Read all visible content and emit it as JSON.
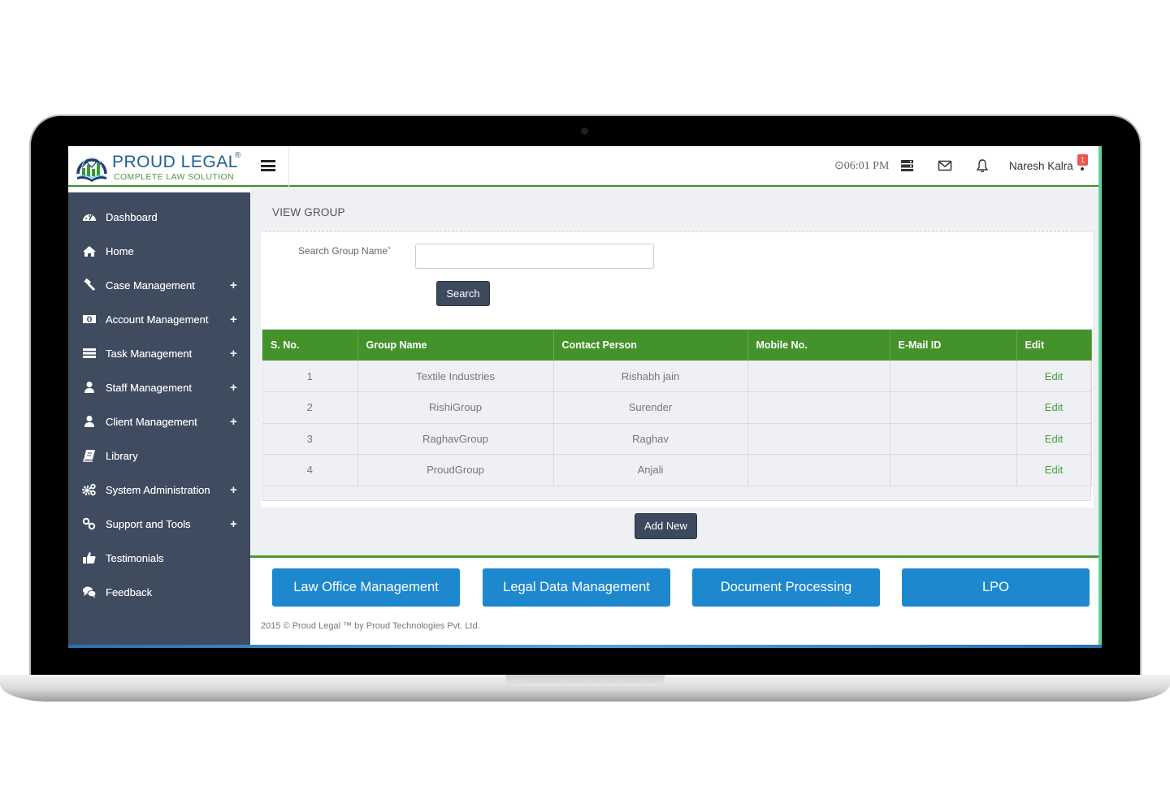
{
  "brand": {
    "title": "PROUD LEGAL",
    "registered": "®",
    "subtitle": "COMPLETE LAW SOLUTION"
  },
  "header": {
    "time": "06:01 PM",
    "user_name": "Naresh Kalra",
    "notification_count": "1",
    "icons": [
      "clock-icon",
      "server-icon",
      "envelope-icon",
      "bell-icon"
    ]
  },
  "sidebar": {
    "items": [
      {
        "label": "Dashboard",
        "icon": "dashboard-icon",
        "expandable": false
      },
      {
        "label": "Home",
        "icon": "home-icon",
        "expandable": false
      },
      {
        "label": "Case Management",
        "icon": "gavel-icon",
        "expandable": true
      },
      {
        "label": "Account Management",
        "icon": "money-icon",
        "expandable": true
      },
      {
        "label": "Task Management",
        "icon": "tasks-icon",
        "expandable": true
      },
      {
        "label": "Staff Management",
        "icon": "user-icon",
        "expandable": true
      },
      {
        "label": "Client Management",
        "icon": "user-icon",
        "expandable": true
      },
      {
        "label": "Library",
        "icon": "book-icon",
        "expandable": false
      },
      {
        "label": "System Administration",
        "icon": "cogs-icon",
        "expandable": true
      },
      {
        "label": "Support and Tools",
        "icon": "link-icon",
        "expandable": true
      },
      {
        "label": "Testimonials",
        "icon": "thumbs-up-icon",
        "expandable": false
      },
      {
        "label": "Feedback",
        "icon": "comments-icon",
        "expandable": false
      }
    ],
    "expand_symbol": "+"
  },
  "main": {
    "page_title": "VIEW GROUP",
    "search": {
      "label": "Search Group Name",
      "required_marker": "*",
      "value": "",
      "placeholder": "",
      "button_label": "Search"
    },
    "table": {
      "columns": [
        "S. No.",
        "Group Name",
        "Contact Person",
        "Mobile No.",
        "E-Mail ID",
        "Edit"
      ],
      "rows": [
        {
          "sno": "1",
          "group_name": "Textile Industries",
          "contact_person": "Rishabh jain",
          "mobile": "",
          "email": "",
          "edit": "Edit"
        },
        {
          "sno": "2",
          "group_name": "RishiGroup",
          "contact_person": "Surender",
          "mobile": "",
          "email": "",
          "edit": "Edit"
        },
        {
          "sno": "3",
          "group_name": "RaghavGroup",
          "contact_person": "Raghav",
          "mobile": "",
          "email": "",
          "edit": "Edit"
        },
        {
          "sno": "4",
          "group_name": "ProudGroup",
          "contact_person": "Anjali",
          "mobile": "",
          "email": "",
          "edit": "Edit"
        }
      ]
    },
    "add_button_label": "Add New"
  },
  "footer": {
    "products": [
      "Law Office Management",
      "Legal Data Management",
      "Document Processing",
      "LPO"
    ],
    "copyright": "2015 © Proud Legal ™ by Proud Technologies Pvt. Ltd."
  },
  "colors": {
    "sidebar_bg": "#3f4b5f",
    "accent_green": "#43932a",
    "product_blue": "#1e88cf",
    "dark_button": "#3d4a5e",
    "badge_red": "#f0544c"
  }
}
